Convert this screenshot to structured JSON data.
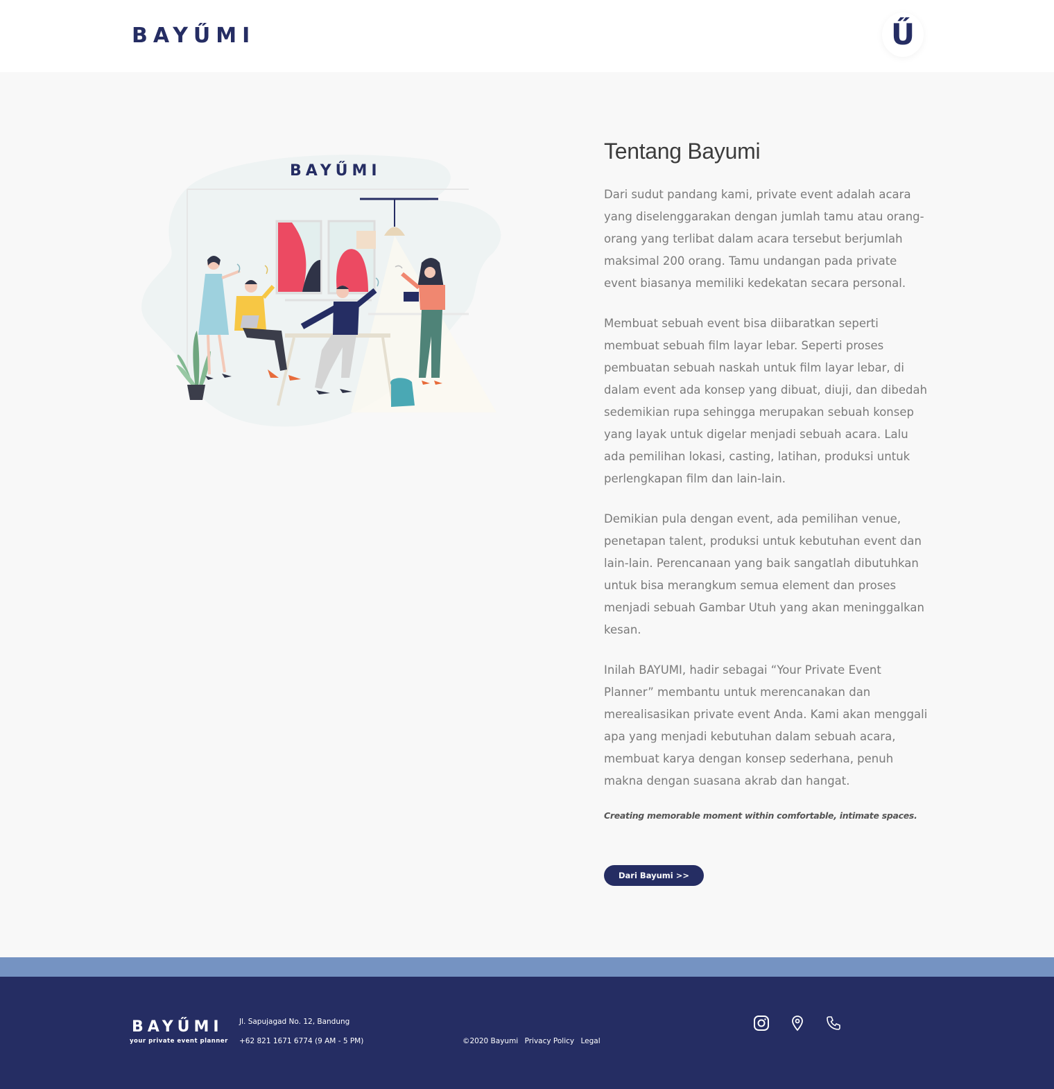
{
  "header": {
    "logo": "BAYŰMI",
    "menu_symbol": "Ű"
  },
  "illustration": {
    "logo": "BAYŰMI"
  },
  "about": {
    "title": "Tentang Bayumi",
    "paragraphs": [
      "Dari sudut pandang kami, private event adalah acara yang diselenggarakan dengan jumlah tamu atau orang-orang yang terlibat dalam acara tersebut berjumlah maksimal 200 orang. Tamu undangan pada private event biasanya memiliki kedekatan secara personal.",
      "Membuat sebuah event bisa diibaratkan seperti membuat sebuah film layar lebar. Seperti proses pembuatan sebuah naskah untuk film layar lebar, di dalam event ada konsep yang dibuat, diuji, dan dibedah sedemikian rupa sehingga merupakan sebuah konsep yang layak untuk digelar menjadi sebuah acara. Lalu ada pemilihan lokasi, casting, latihan, produksi untuk perlengkapan film dan lain-lain.",
      "Demikian pula dengan event, ada pemilihan venue, penetapan talent, produksi untuk kebutuhan event dan lain-lain. Perencanaan yang baik sangatlah dibutuhkan untuk bisa merangkum semua element dan proses menjadi sebuah Gambar Utuh yang akan meninggalkan kesan.",
      "Inilah BAYUMI, hadir sebagai “Your Private Event Planner” membantu untuk merencanakan dan merealisasikan private event Anda. Kami akan menggali apa yang menjadi kebutuhan dalam sebuah acara, membuat karya dengan konsep sederhana, penuh makna dengan suasana akrab dan hangat."
    ],
    "tagline": "Creating memorable moment within comfortable, intimate spaces.",
    "cta_label": "Dari Bayumi >>"
  },
  "footer": {
    "logo": "BAYŰMI",
    "tagline": "your private event planner",
    "address": "Jl. Sapujagad No. 12, Bandung",
    "phone": "+62 821 1671 6774 (9 AM - 5 PM)",
    "copyright": "©2020 Bayumi",
    "links": [
      "Privacy Policy",
      "Legal"
    ],
    "icons": [
      "instagram-icon",
      "location-pin-icon",
      "phone-icon"
    ]
  },
  "colors": {
    "brand": "#252d63",
    "band": "#7593c2",
    "page_bg": "#f8f8f8"
  }
}
